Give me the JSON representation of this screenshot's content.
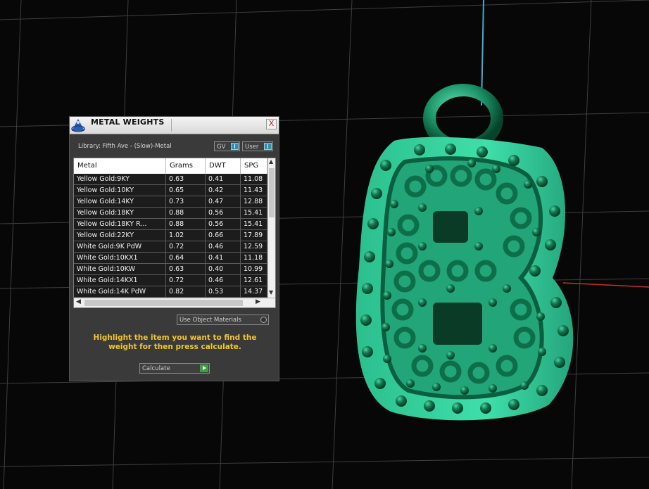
{
  "panel": {
    "title": "METAL WEIGHTS",
    "close": "X",
    "library_label": "Library: Fifth Ave - (Slow)-Metal",
    "gv_label": "GV",
    "user_label": "User",
    "columns": [
      "Metal",
      "Grams",
      "DWT",
      "SPG"
    ],
    "rows": [
      [
        "Yellow Gold:9KY",
        "0.63",
        "0.41",
        "11.08"
      ],
      [
        "Yellow Gold:10KY",
        "0.65",
        "0.42",
        "11.43"
      ],
      [
        "Yellow Gold:14KY",
        "0.73",
        "0.47",
        "12.88"
      ],
      [
        "Yellow Gold:18KY",
        "0.88",
        "0.56",
        "15.41"
      ],
      [
        "Yellow Gold:18KY R...",
        "0.88",
        "0.56",
        "15.41"
      ],
      [
        "Yellow Gold:22KY",
        "1.02",
        "0.66",
        "17.89"
      ],
      [
        "White Gold:9K PdW",
        "0.72",
        "0.46",
        "12.59"
      ],
      [
        "White Gold:10KX1",
        "0.64",
        "0.41",
        "11.18"
      ],
      [
        "White Gold:10KW",
        "0.63",
        "0.40",
        "10.99"
      ],
      [
        "White Gold:14KX1",
        "0.72",
        "0.46",
        "12.61"
      ],
      [
        "White Gold:14K PdW",
        "0.82",
        "0.53",
        "14.37"
      ]
    ],
    "use_object_materials": "Use Object Materials",
    "hint": "Highlight the item you want to find the weight for then press calculate.",
    "calculate_label": "Calculate"
  },
  "colors": {
    "model": "#2ecf9a",
    "grid": "#444444",
    "axis_y": "#4aa8c8",
    "axis_x": "#c03030",
    "hint": "#f4c430"
  }
}
